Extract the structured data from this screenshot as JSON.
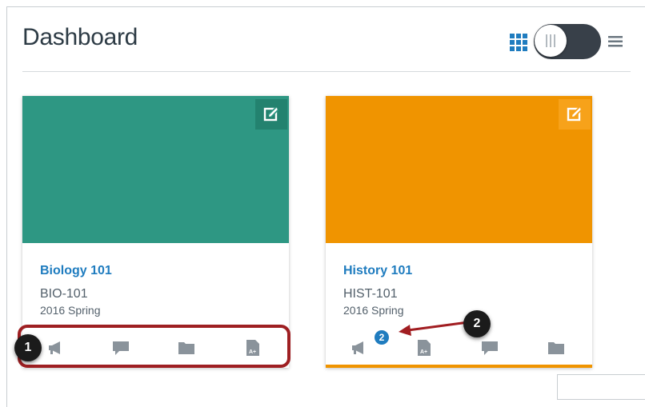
{
  "page": {
    "title": "Dashboard"
  },
  "view_toggle": {
    "card_view_icon": "grid-icon",
    "list_view_icon": "list-icon",
    "state": "card-view"
  },
  "cards": [
    {
      "title": "Biology 101",
      "code": "BIO-101",
      "term": "2016 Spring",
      "color": "#2e9783",
      "actions": [
        "announcements-icon",
        "discussions-icon",
        "files-icon",
        "assignments-icon"
      ]
    },
    {
      "title": "History 101",
      "code": "HIST-101",
      "term": "2016 Spring",
      "color": "#f09400",
      "actions": [
        "announcements-icon",
        "assignments-icon",
        "discussions-icon",
        "files-icon"
      ],
      "announcement_badge": "2"
    }
  ],
  "callouts": {
    "first": "1",
    "second": "2"
  },
  "colors": {
    "link": "#1f7cbf",
    "highlight": "#9e1f22",
    "badge": "#1f7cbf"
  }
}
